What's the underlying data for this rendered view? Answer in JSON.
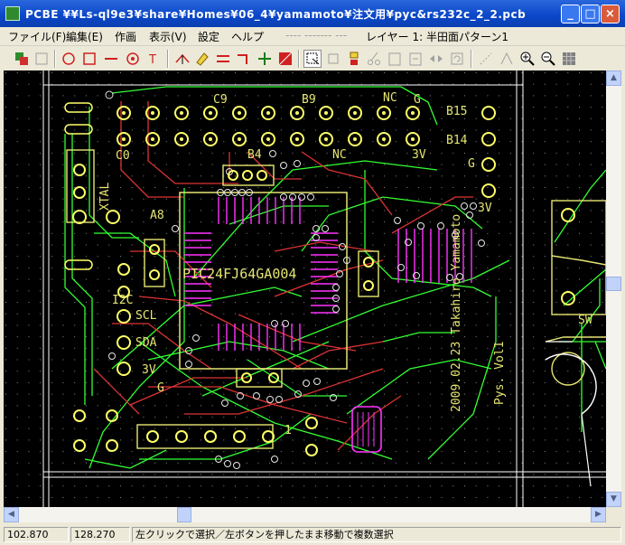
{
  "window": {
    "title": "PCBE  ¥¥Ls-ql9e3¥share¥Homes¥06_4¥yamamoto¥注文用¥pyc&rs232c_2_2.pcb",
    "minimize": "_",
    "maximize": "□",
    "close": "×"
  },
  "menu": {
    "items": [
      "ファイル(F)",
      "編集(E)",
      "作画",
      "表示(V)",
      "設定",
      "ヘルプ"
    ],
    "dashes": "----  -------  ---",
    "layer_info": "レイヤー 1: 半田面パターン1"
  },
  "board": {
    "chip_label": "PIC24FJ64GA004",
    "labels": {
      "c9": "C9",
      "b9": "B9",
      "nc_top": "NC",
      "g_top": "G",
      "b15": "B15",
      "b14": "B14",
      "c0": "C0",
      "b4": "B4",
      "nc_mid": "NC",
      "g_right": "G",
      "xtal": "XTAL",
      "a8": "A8",
      "i2c": "I2C",
      "scl": "SCL",
      "sda": "SDA",
      "v3_left": "3V",
      "v3_top": "3V",
      "v3_right": "3V",
      "g_left": "G",
      "one": "1",
      "sw": "SW"
    },
    "vertical_text_1": "2009.02.23 Takahiro Yamamoto",
    "vertical_text_2": "Pys. Vol1"
  },
  "status": {
    "x": "102.870",
    "y": "128.270",
    "message": "左クリックで選択／左ボタンを押したまま移動で複数選択"
  },
  "scroll": {
    "up": "▲",
    "down": "▼",
    "left": "◀",
    "right": "▶"
  },
  "colors": {
    "background": "#000000",
    "trace_green": "#33ff33",
    "trace_red": "#dd3333",
    "pad_yellow": "#ffff66",
    "silk_yellow": "#e6e673",
    "pad_magenta": "#ff33ff",
    "board_outline": "#ffffff"
  },
  "toolbar": {
    "icons": [
      "layers-icon",
      "flip-icon",
      "circle-icon",
      "rect-icon",
      "line-icon",
      "via-icon",
      "text-icon",
      "wire-icon",
      "erase-icon",
      "bus-icon",
      "route-icon",
      "route2-icon",
      "fill-icon",
      "select-icon",
      "move-icon",
      "copy-icon",
      "cut-icon",
      "paste-icon",
      "flip2-icon",
      "rotate-icon",
      "measure-icon",
      "fit-icon",
      "zoom-in-icon",
      "zoom-out-icon",
      "grid-icon"
    ]
  }
}
